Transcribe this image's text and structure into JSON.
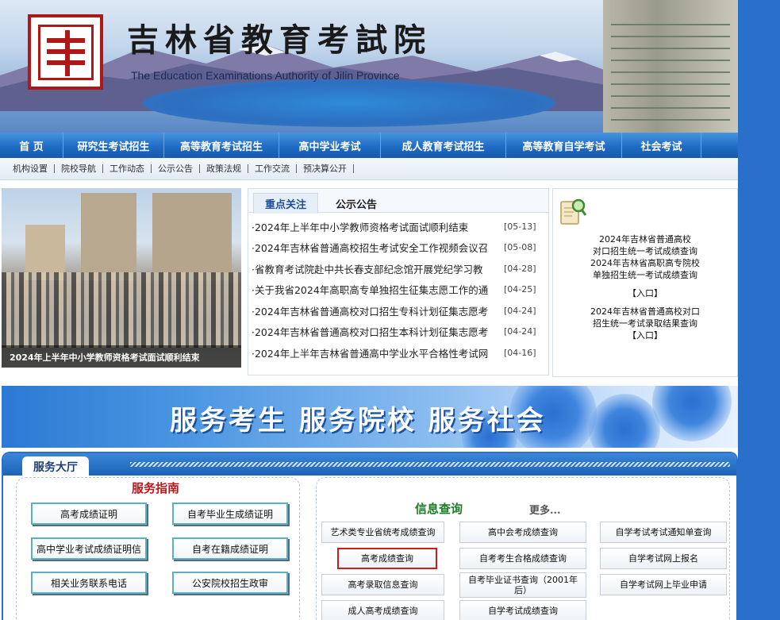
{
  "header": {
    "title": "吉林省教育考試院",
    "subtitle": "The Education Examinations Authority of Jilin Province"
  },
  "nav": [
    {
      "label": "首 页"
    },
    {
      "label": "研究生考试招生"
    },
    {
      "label": "高等教育考试招生"
    },
    {
      "label": "高中学业考试"
    },
    {
      "label": "成人教育考试招生"
    },
    {
      "label": "高等教育自学考试"
    },
    {
      "label": "社会考试"
    }
  ],
  "subnav": [
    "机构设置",
    "院校导航",
    "工作动态",
    "公示公告",
    "政策法规",
    "工作交流",
    "预决算公开"
  ],
  "photo": {
    "caption": "2024年上半年中小学教师资格考试面试顺利结束"
  },
  "news": {
    "tabs": [
      "重点关注",
      "公示公告"
    ],
    "items": [
      {
        "title": "·2024年上半年中小学教师资格考试面试顺利结束",
        "date": "[05-13]"
      },
      {
        "title": "·2024年吉林省普通高校招生考试安全工作视频会议召",
        "date": "[05-08]"
      },
      {
        "title": "·省教育考试院赴中共长春支部纪念馆开展党纪学习教",
        "date": "[04-28]"
      },
      {
        "title": "·关于我省2024年高职高专单独招生征集志愿工作的通",
        "date": "[04-25]"
      },
      {
        "title": "·2024年吉林省普通高校对口招生专科计划征集志愿考",
        "date": "[04-24]"
      },
      {
        "title": "·2024年吉林省普通高校对口招生本科计划征集志愿考",
        "date": "[04-24]"
      },
      {
        "title": "·2024年上半年吉林省普通高中学业水平合格性考试网",
        "date": "[04-16]"
      }
    ]
  },
  "quick": {
    "lines1": [
      "2024年吉林省普通高校",
      "对口招生统一考试成绩查询",
      "2024年吉林省高职高专院校",
      "单独招生统一考试成绩查询"
    ],
    "entry1": "【入口】",
    "lines2": [
      "2024年吉林省普通高校对口",
      "招生统一考试录取结果查询"
    ],
    "entry2": "【入口】"
  },
  "slogan": "服务考生 服务院校 服务社会",
  "hall": {
    "title": "服务大厅",
    "guide_title": "服务指南",
    "guide_buttons": [
      "高考成绩证明",
      "自考毕业生成绩证明",
      "高中学业考试成绩证明信",
      "自考在籍成绩证明",
      "相关业务联系电话",
      "公安院校招生政审"
    ],
    "query_title": "信息查询",
    "more": "更多...",
    "query_buttons": [
      "艺术类专业省统考成绩查询",
      "高中会考成绩查询",
      "自学考试考试通知单查询",
      "高考成绩查询",
      "自考考生合格成绩查询",
      "自学考试网上报名",
      "高考录取信息查询",
      "自考毕业证书查询（2001年后）",
      "自学考试网上毕业申请",
      "成人高考成绩查询",
      "自学考试成绩查询"
    ]
  },
  "colors": {
    "brand_blue": "#1f6cc4",
    "seal_red": "#b01818",
    "highlight_red": "#d11a1a"
  }
}
